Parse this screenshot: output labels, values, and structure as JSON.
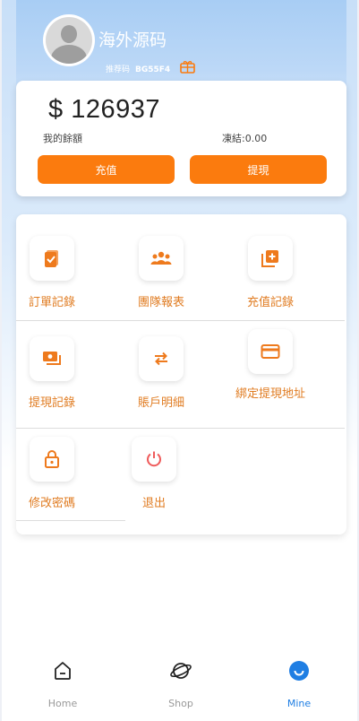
{
  "profile": {
    "username": "海外源码",
    "invite_label": "推荐码",
    "invite_code": "BG55F4"
  },
  "balance": {
    "currency_symbol": "$",
    "amount": "126937",
    "label": "我的餘額",
    "frozen": "凍結:0.00"
  },
  "actions": {
    "recharge": "充值",
    "withdraw": "提現"
  },
  "menu": [
    {
      "label": "訂單記錄",
      "icon": "order-icon"
    },
    {
      "label": "團隊報表",
      "icon": "team-icon"
    },
    {
      "label": "充值記錄",
      "icon": "add-record-icon"
    },
    {
      "label": "提現記錄",
      "icon": "cash-icon"
    },
    {
      "label": "賬戶明細",
      "icon": "swap-icon"
    },
    {
      "label": "綁定提現地址",
      "icon": "card-icon"
    },
    {
      "label": "修改密碼",
      "icon": "lock-icon"
    },
    {
      "label": "退出",
      "icon": "power-icon"
    }
  ],
  "tabs": [
    {
      "label": "Home",
      "icon": "home-icon"
    },
    {
      "label": "Shop",
      "icon": "planet-icon"
    },
    {
      "label": "Mine",
      "icon": "smile-icon",
      "active": true
    }
  ],
  "colors": {
    "accent": "#fb7b0e",
    "menu_text": "#e07c22",
    "tab_active": "#1f7ee3"
  }
}
